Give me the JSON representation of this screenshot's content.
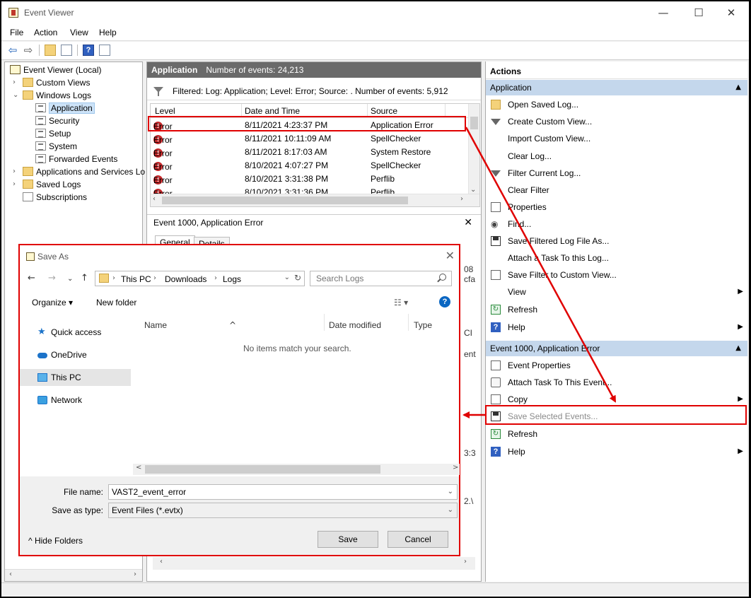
{
  "window": {
    "title": "Event Viewer",
    "controls": {
      "minimize": "—",
      "maximize": "☐",
      "close": "✕"
    }
  },
  "menu": [
    "File",
    "Action",
    "View",
    "Help"
  ],
  "toolbar": {
    "back": "⇦",
    "forward": "⇨",
    "help": "?"
  },
  "tree": {
    "items": [
      {
        "label": "Event Viewer (Local)",
        "expander": "",
        "icon": "event-viewer-icon"
      },
      {
        "label": "Custom Views",
        "expander": "›",
        "icon": "folder-icon"
      },
      {
        "label": "Windows Logs",
        "expander": "⌄",
        "icon": "folder-icon"
      },
      {
        "label": "Application",
        "expander": "",
        "icon": "log-icon",
        "selected": true
      },
      {
        "label": "Security",
        "expander": "",
        "icon": "log-icon"
      },
      {
        "label": "Setup",
        "expander": "",
        "icon": "log-icon"
      },
      {
        "label": "System",
        "expander": "",
        "icon": "log-icon"
      },
      {
        "label": "Forwarded Events",
        "expander": "",
        "icon": "log-icon"
      },
      {
        "label": "Applications and Services Lo",
        "expander": "›",
        "icon": "folder-icon"
      },
      {
        "label": "Saved Logs",
        "expander": "›",
        "icon": "folder-icon"
      },
      {
        "label": "Subscriptions",
        "expander": "",
        "icon": "subscriptions-icon"
      }
    ],
    "scroll_left": "‹",
    "scroll_right": "›"
  },
  "log_pane": {
    "name": "Application",
    "count_text": "Number of events: 24,213",
    "filter_text": "Filtered: Log: Application; Level: Error; Source: . Number of events: 5,912",
    "columns": [
      "Level",
      "Date and Time",
      "Source"
    ],
    "rows": [
      {
        "level": "Error",
        "datetime": "8/11/2021 4:23:37 PM",
        "source": "Application Error"
      },
      {
        "level": "Error",
        "datetime": "8/11/2021 10:11:09 AM",
        "source": "SpellChecker"
      },
      {
        "level": "Error",
        "datetime": "8/11/2021 8:17:03 AM",
        "source": "System Restore"
      },
      {
        "level": "Error",
        "datetime": "8/10/2021 4:07:27 PM",
        "source": "SpellChecker"
      },
      {
        "level": "Error",
        "datetime": "8/10/2021 3:31:38 PM",
        "source": "Perflib"
      },
      {
        "level": "Error",
        "datetime": "8/10/2021 3:31:36 PM",
        "source": "Perflib"
      }
    ],
    "scroll_up": "⌃",
    "scroll_down": "⌄",
    "scroll_left": "‹",
    "scroll_right": "›"
  },
  "event_pane": {
    "title": "Event 1000, Application Error",
    "close": "✕",
    "tabs": [
      "General",
      "Details"
    ],
    "bleed": [
      "08",
      "cfa",
      "CI",
      "ent",
      "3:3",
      "2.\\"
    ]
  },
  "actions": {
    "title": "Actions",
    "section1": {
      "label": "Application",
      "caret": "▲",
      "items": [
        {
          "label": "Open Saved Log...",
          "icon": "open-folder-icon"
        },
        {
          "label": "Create Custom View...",
          "icon": "filter-icon"
        },
        {
          "label": "Import Custom View...",
          "icon": ""
        },
        {
          "label": "Clear Log...",
          "icon": ""
        },
        {
          "label": "Filter Current Log...",
          "icon": "filter-icon"
        },
        {
          "label": "Clear Filter",
          "icon": ""
        },
        {
          "label": "Properties",
          "icon": "properties-icon"
        },
        {
          "label": "Find...",
          "icon": "find-icon"
        },
        {
          "label": "Save Filtered Log File As...",
          "icon": "save-icon"
        },
        {
          "label": "Attach a Task To this Log...",
          "icon": ""
        },
        {
          "label": "Save Filter to Custom View...",
          "icon": "save-filter-icon"
        },
        {
          "label": "View",
          "icon": "",
          "submenu": "▶"
        },
        {
          "label": "Refresh",
          "icon": "refresh-icon"
        },
        {
          "label": "Help",
          "icon": "help-icon",
          "submenu": "▶"
        }
      ]
    },
    "section2": {
      "label": "Event 1000, Application Error",
      "caret": "▲",
      "items": [
        {
          "label": "Event Properties",
          "icon": "properties-icon"
        },
        {
          "label": "Attach Task To This Event...",
          "icon": "task-icon"
        },
        {
          "label": "Copy",
          "icon": "copy-icon",
          "submenu": "▶"
        },
        {
          "label": "Save Selected Events...",
          "icon": "save-icon",
          "disabled": true
        },
        {
          "label": "Refresh",
          "icon": "refresh-icon"
        },
        {
          "label": "Help",
          "icon": "help-icon",
          "submenu": "▶"
        }
      ]
    }
  },
  "save_dialog": {
    "title": "Save As",
    "close": "✕",
    "nav": {
      "back": "←",
      "forward": "→",
      "recent": "⌄",
      "up": "↑"
    },
    "breadcrumb": [
      "This PC",
      "Downloads",
      "Logs"
    ],
    "separator": "›",
    "address_dropdown": "⌄",
    "refresh": "↻",
    "search_placeholder": "Search Logs",
    "organize": "Organize ▾",
    "new_folder": "New folder",
    "view_toggle": "☷ ▾",
    "help": "?",
    "nav_pane": [
      {
        "label": "Quick access",
        "icon": "star-icon"
      },
      {
        "label": "OneDrive",
        "icon": "cloud-icon"
      },
      {
        "label": "This PC",
        "icon": "computer-icon",
        "selected": true
      },
      {
        "label": "Network",
        "icon": "network-icon"
      }
    ],
    "columns": [
      "Name",
      "Date modified",
      "Type"
    ],
    "sort_indicator": "^",
    "empty_message": "No items match your search.",
    "scroll_left": "<",
    "scroll_right": ">",
    "file_name_label": "File name:",
    "file_name": "VAST2_event_error",
    "save_as_type_label": "Save as type:",
    "save_as_type": "Event Files (*.evtx)",
    "dropdown": "⌄",
    "hide_folders": "^  Hide Folders",
    "save_button": "Save",
    "cancel_button": "Cancel"
  },
  "annotation": {
    "color": "#e00000"
  }
}
